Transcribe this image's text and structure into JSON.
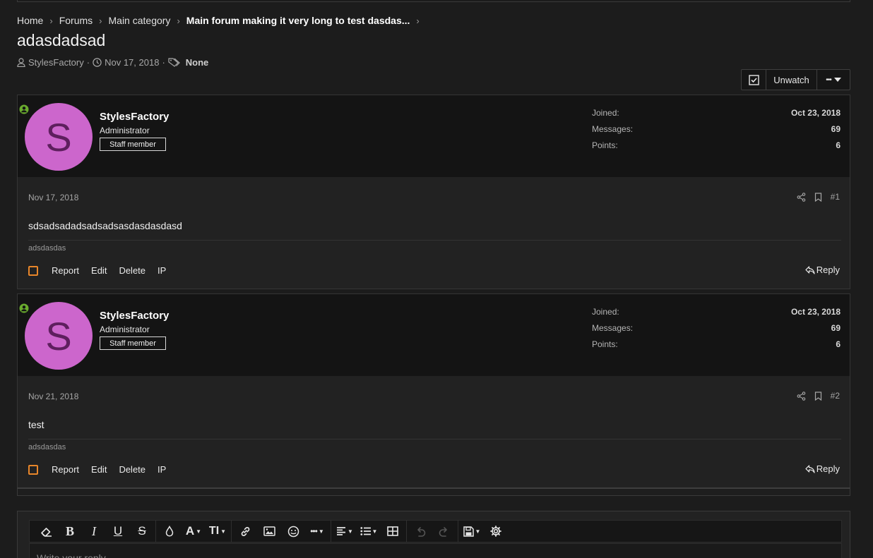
{
  "breadcrumb": [
    "Home",
    "Forums",
    "Main category",
    "Main forum making it very long to test dasdas..."
  ],
  "thread": {
    "title": "adasdadsad",
    "author": "StylesFactory",
    "date": "Nov 17, 2018",
    "tags": "None"
  },
  "actions": {
    "unwatch_label": "Unwatch",
    "more_label": "•••"
  },
  "posts": [
    {
      "avatar_letter": "S",
      "username": "StylesFactory",
      "user_title": "Administrator",
      "badge": "Staff member",
      "stats": [
        {
          "label": "Joined:",
          "value": "Oct 23, 2018"
        },
        {
          "label": "Messages:",
          "value": "69"
        },
        {
          "label": "Points:",
          "value": "6"
        }
      ],
      "date": "Nov 17, 2018",
      "number": "#1",
      "body": "sdsadsadadsadsadsasdasdasdasd",
      "signature": "adsdasdas",
      "links": [
        "Report",
        "Edit",
        "Delete",
        "IP"
      ],
      "reply_label": "Reply"
    },
    {
      "avatar_letter": "S",
      "username": "StylesFactory",
      "user_title": "Administrator",
      "badge": "Staff member",
      "stats": [
        {
          "label": "Joined:",
          "value": "Oct 23, 2018"
        },
        {
          "label": "Messages:",
          "value": "69"
        },
        {
          "label": "Points:",
          "value": "6"
        }
      ],
      "date": "Nov 21, 2018",
      "number": "#2",
      "body": "test",
      "signature": "adsdasdas",
      "links": [
        "Report",
        "Edit",
        "Delete",
        "IP"
      ],
      "reply_label": "Reply"
    }
  ],
  "editor": {
    "placeholder": "Write your reply..."
  },
  "colors": {
    "avatar": "#cc66cc",
    "online": "#6aab2e",
    "checkbox": "#e8862a"
  }
}
